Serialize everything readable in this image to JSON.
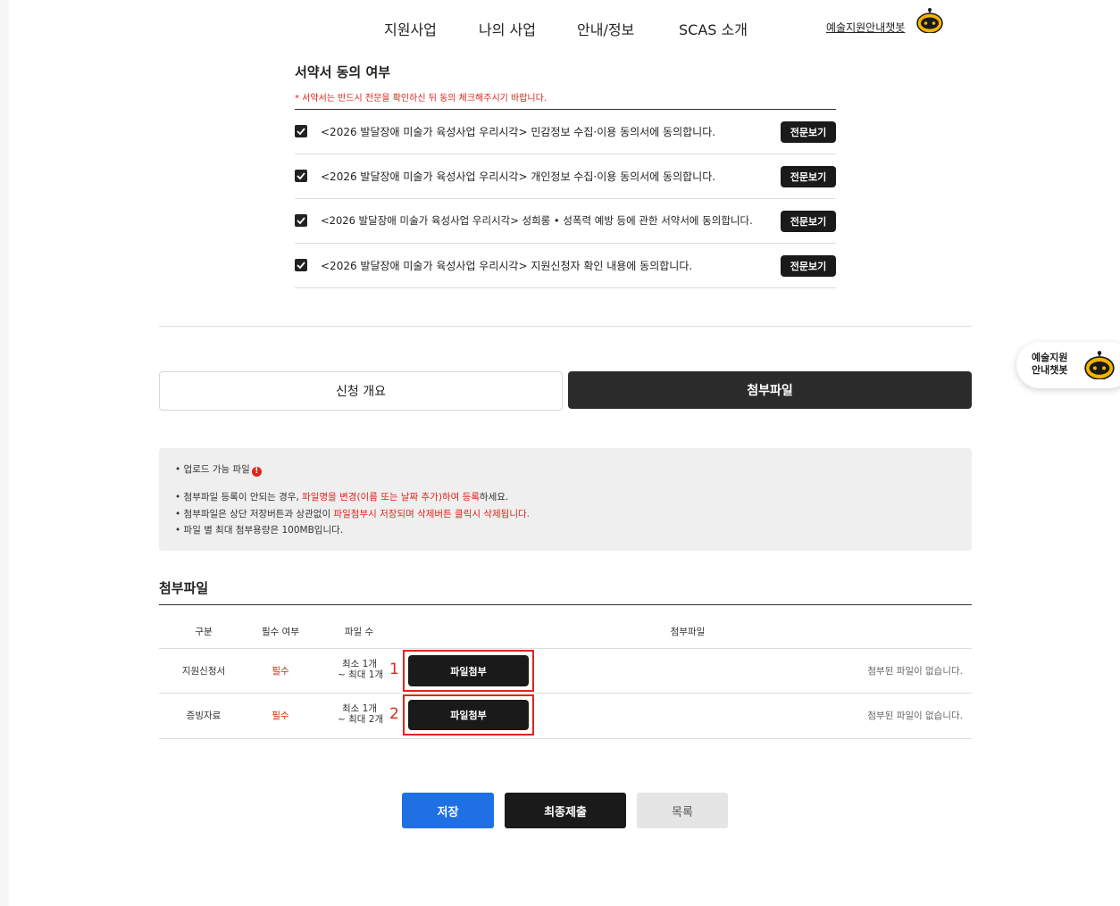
{
  "nav": {
    "items": [
      "지원사업",
      "나의 사업",
      "안내/정보",
      "SCAS 소개"
    ],
    "chatbot_link": "예술지원안내챗봇"
  },
  "consent": {
    "title": "서약서 동의 여부",
    "note": "* 서약서는 반드시 전문을 확인하신 뒤 동의 체크해주시기 바랍니다.",
    "items": [
      {
        "text": "<2026 발달장애 미술가 육성사업 우리시각> 민감정보 수집·이용 동의서에 동의합니다.",
        "checked": true,
        "button": "전문보기"
      },
      {
        "text": "<2026 발달장애 미술가 육성사업 우리시각> 개인정보 수집·이용 동의서에 동의합니다.",
        "checked": true,
        "button": "전문보기"
      },
      {
        "text": "<2026 발달장애 미술가 육성사업 우리시각> 성희롱 • 성폭력 예방 등에 관한 서약서에 동의합니다.",
        "checked": true,
        "button": "전문보기"
      },
      {
        "text": "<2026 발달장애 미술가 육성사업 우리시각> 지원신청자 확인 내용에 동의합니다.",
        "checked": true,
        "button": "전문보기"
      }
    ]
  },
  "tabs": [
    {
      "label": "신청 개요",
      "active": false
    },
    {
      "label": "첨부파일",
      "active": true
    }
  ],
  "info": {
    "upload_label": "• 업로드 가능 파일",
    "line2_a": "• 첨부파일 등록이 안되는 경우, ",
    "line2_red": "파일명을 변경(이름 또는 날짜 추가)하여 등록",
    "line2_b": "하세요.",
    "line3_a": "• 첨부파일은 상단 저장버튼과 상관없이 ",
    "line3_red": "파일첨부시 저장되며 삭제버튼 클릭시 삭제됩니다.",
    "line4": "• 파일 별 최대 첨부용량은 100MB입니다."
  },
  "attachments": {
    "title": "첨부파일",
    "headers": [
      "구분",
      "필수 여부",
      "파일 수",
      "첨부파일"
    ],
    "rows": [
      {
        "category": "지원신청서",
        "required": "필수",
        "count_min": "최소 1개",
        "count_max": "~ 최대 1개",
        "annotation": "1",
        "button": "파일첨부",
        "status": "첨부된 파일이 없습니다."
      },
      {
        "category": "증빙자료",
        "required": "필수",
        "count_min": "최소 1개",
        "count_max": "~ 최대 2개",
        "annotation": "2",
        "button": "파일첨부",
        "status": "첨부된 파일이 없습니다."
      }
    ]
  },
  "buttons": {
    "save": "저장",
    "submit": "최종제출",
    "list": "목록"
  },
  "float_bot": {
    "line1": "예술지원",
    "line2": "안내챗봇"
  },
  "colors": {
    "accent_red": "#e2231a",
    "primary_blue": "#1f6fe5",
    "dark": "#1a1a1a",
    "bot_yellow": "#f5b400"
  }
}
